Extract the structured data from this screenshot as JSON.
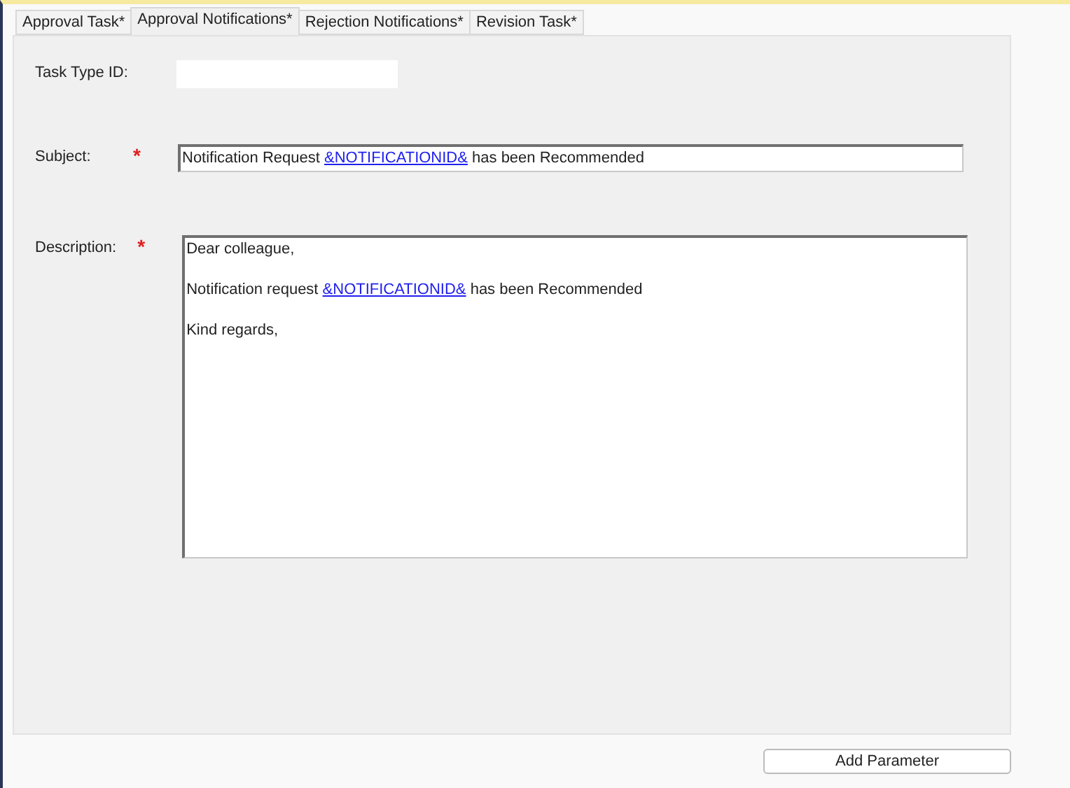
{
  "tabs": [
    {
      "label": "Approval Task*",
      "selected": false
    },
    {
      "label": "Approval Notifications*",
      "selected": true
    },
    {
      "label": "Rejection Notifications*",
      "selected": false
    },
    {
      "label": "Revision Task*",
      "selected": false
    }
  ],
  "task_type_id": {
    "label": "Task Type ID:"
  },
  "subject": {
    "label": "Subject:",
    "required": true,
    "required_mark": "*",
    "segments": [
      {
        "kind": "text",
        "text": "Notification Request "
      },
      {
        "kind": "link",
        "text": "&NOTIFICATIONID&"
      },
      {
        "kind": "text",
        "text": " has been Recommended"
      }
    ]
  },
  "description": {
    "label": "Description:",
    "required": true,
    "required_mark": "*",
    "paragraphs": [
      [
        {
          "kind": "text",
          "text": "Dear colleague,"
        }
      ],
      [
        {
          "kind": "text",
          "text": "Notification request "
        },
        {
          "kind": "link",
          "text": "&NOTIFICATIONID&"
        },
        {
          "kind": "text",
          "text": " has been Recommended"
        }
      ],
      [
        {
          "kind": "text",
          "text": "Kind regards,"
        }
      ]
    ]
  },
  "add_parameter_button": "Add Parameter"
}
